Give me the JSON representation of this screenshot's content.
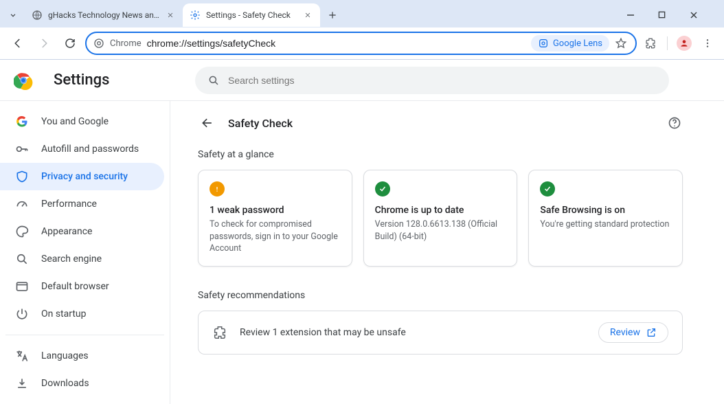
{
  "browser": {
    "tabs": [
      {
        "title": "gHacks Technology News and A",
        "active": false
      },
      {
        "title": "Settings - Safety Check",
        "active": true
      }
    ],
    "omnibox": {
      "site_label": "Chrome",
      "url": "chrome://settings/safetyCheck"
    },
    "lens_label": "Google Lens"
  },
  "settings": {
    "app_title": "Settings",
    "search_placeholder": "Search settings",
    "sidebar": [
      {
        "id": "you-google",
        "label": "You and Google"
      },
      {
        "id": "autofill",
        "label": "Autofill and passwords"
      },
      {
        "id": "privacy",
        "label": "Privacy and security",
        "active": true
      },
      {
        "id": "performance",
        "label": "Performance"
      },
      {
        "id": "appearance",
        "label": "Appearance"
      },
      {
        "id": "search-engine",
        "label": "Search engine"
      },
      {
        "id": "default-browser",
        "label": "Default browser"
      },
      {
        "id": "on-startup",
        "label": "On startup"
      }
    ],
    "sidebar_extra": [
      {
        "id": "languages",
        "label": "Languages"
      },
      {
        "id": "downloads",
        "label": "Downloads"
      }
    ],
    "page": {
      "title": "Safety Check",
      "glance_label": "Safety at a glance",
      "cards": [
        {
          "status": "warn",
          "title": "1 weak password",
          "desc": "To check for compromised passwords, sign in to your Google Account"
        },
        {
          "status": "ok",
          "title": "Chrome is up to date",
          "desc": "Version 128.0.6613.138 (Official Build) (64-bit)"
        },
        {
          "status": "ok",
          "title": "Safe Browsing is on",
          "desc": "You're getting standard protection"
        }
      ],
      "reco_label": "Safety recommendations",
      "reco_text": "Review 1 extension that may be unsafe",
      "review_label": "Review"
    }
  }
}
